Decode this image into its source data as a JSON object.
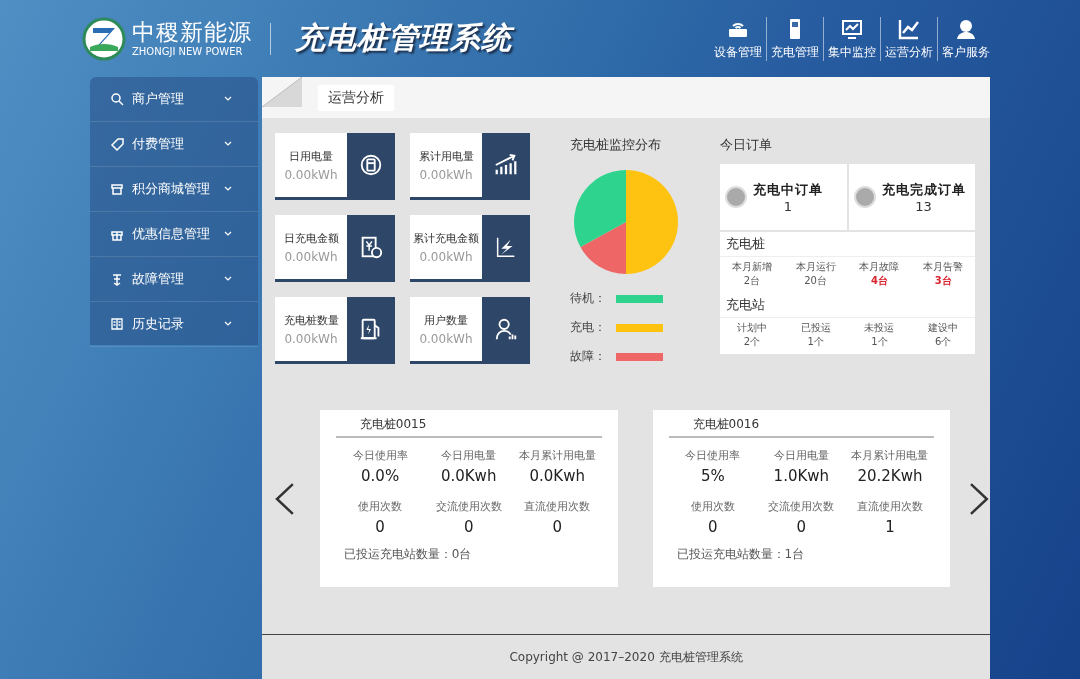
{
  "header": {
    "logo_name": "中稷新能源",
    "logo_subtitle": "ZHONGJI NEW POWER",
    "system_title": "充电桩管理系统",
    "nav": [
      {
        "label": "设备管理"
      },
      {
        "label": "充电管理"
      },
      {
        "label": "集中监控"
      },
      {
        "label": "运营分析"
      },
      {
        "label": "客户服务"
      }
    ]
  },
  "sidebar": {
    "items": [
      {
        "label": "商户管理"
      },
      {
        "label": "付费管理"
      },
      {
        "label": "积分商城管理"
      },
      {
        "label": "优惠信息管理"
      },
      {
        "label": "故障管理"
      },
      {
        "label": "历史记录"
      }
    ]
  },
  "page_tab": "运营分析",
  "stats": [
    {
      "label": "日用电量",
      "value": "0.00kWh"
    },
    {
      "label": "累计用电量",
      "value": "0.00kWh"
    },
    {
      "label": "日充电金额",
      "value": "0.00kWh"
    },
    {
      "label": "累计充电金额",
      "value": "0.00kWh"
    },
    {
      "label": "充电桩数量",
      "value": "0.00kWh"
    },
    {
      "label": "用户数量",
      "value": "0.00kWh"
    }
  ],
  "distribution": {
    "title": "充电桩监控分布",
    "legend": [
      {
        "label": "待机：",
        "color": "#2ed48e"
      },
      {
        "label": "充电：",
        "color": "#fdc310"
      },
      {
        "label": "故障：",
        "color": "#ee6666"
      }
    ]
  },
  "orders": {
    "title": "今日订单",
    "items": [
      {
        "label": "充电中订单",
        "count": "1"
      },
      {
        "label": "充电完成订单",
        "count": "13"
      }
    ],
    "groups": [
      {
        "title": "充电桩",
        "stats": [
          {
            "label": "本月新增",
            "value": "2台",
            "alert": false
          },
          {
            "label": "本月运行",
            "value": "20台",
            "alert": false
          },
          {
            "label": "本月故障",
            "value": "4台",
            "alert": true
          },
          {
            "label": "本月告警",
            "value": "3台",
            "alert": true
          }
        ]
      },
      {
        "title": "充电站",
        "stats": [
          {
            "label": "计划中",
            "value": "2个",
            "alert": false
          },
          {
            "label": "已投运",
            "value": "1个",
            "alert": false
          },
          {
            "label": "未投运",
            "value": "1个",
            "alert": false
          },
          {
            "label": "建设中",
            "value": "6个",
            "alert": false
          }
        ]
      }
    ]
  },
  "piles": [
    {
      "name": "充电桩0015",
      "metrics": [
        {
          "label": "今日使用率",
          "value": "0.0%"
        },
        {
          "label": "今日用电量",
          "value": "0.0Kwh"
        },
        {
          "label": "本月累计用电量",
          "value": "0.0Kwh"
        },
        {
          "label": "使用次数",
          "value": "0"
        },
        {
          "label": "交流使用次数",
          "value": "0"
        },
        {
          "label": "直流使用次数",
          "value": "0"
        }
      ],
      "footer": "已投运充电站数量：0台"
    },
    {
      "name": "充电桩0016",
      "metrics": [
        {
          "label": "今日使用率",
          "value": "5%"
        },
        {
          "label": "今日用电量",
          "value": "1.0Kwh"
        },
        {
          "label": "本月累计用电量",
          "value": "20.2Kwh"
        },
        {
          "label": "使用次数",
          "value": "0"
        },
        {
          "label": "交流使用次数",
          "value": "0"
        },
        {
          "label": "直流使用次数",
          "value": "1"
        }
      ],
      "footer": "已投运充电站数量：1台"
    }
  ],
  "footer": "Copyright @ 2017–2020  充电桩管理系统"
}
